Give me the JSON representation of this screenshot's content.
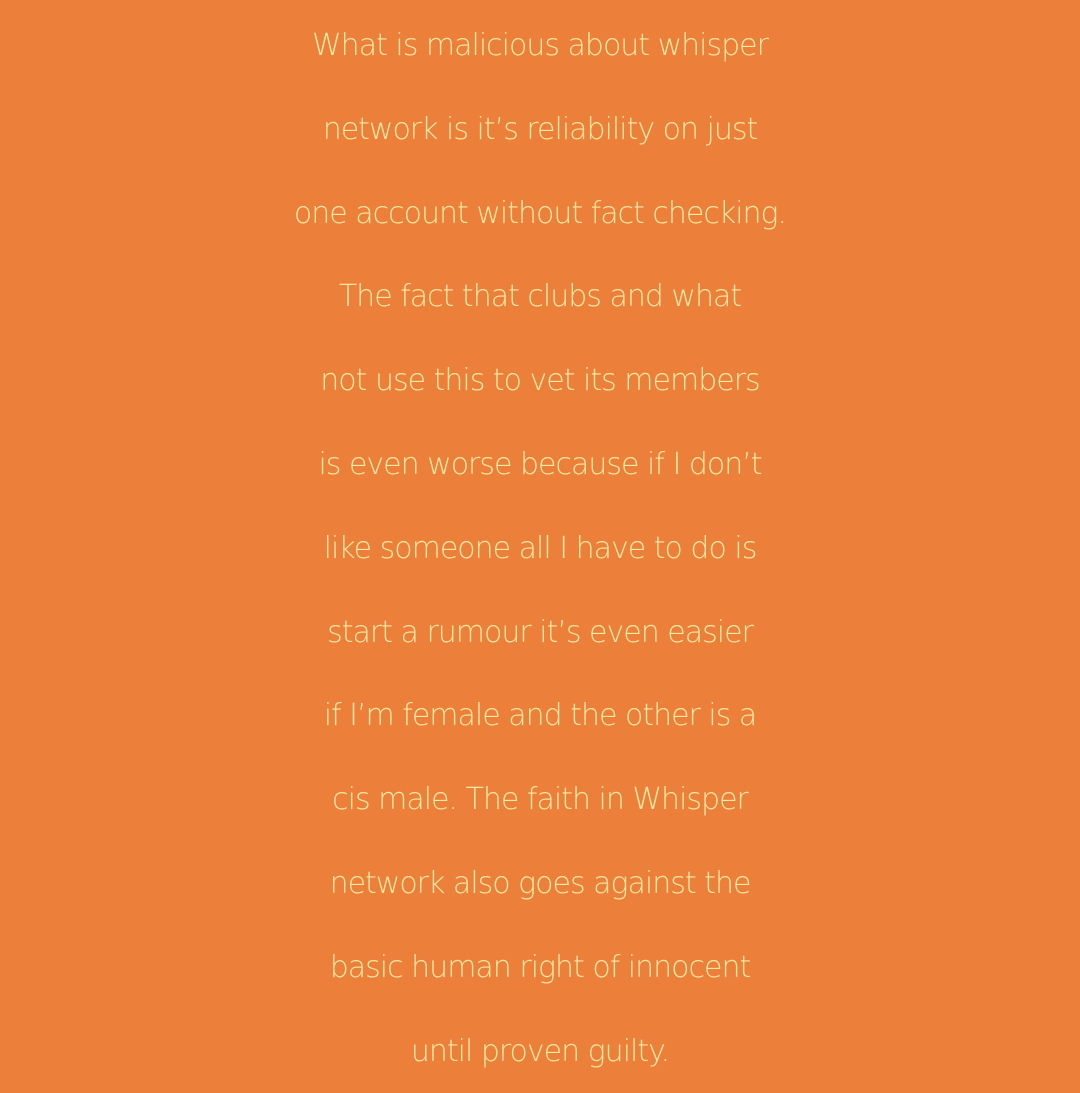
{
  "post": {
    "background_color": "#ec7f39",
    "text_color": "#fbeaa4",
    "lines": [
      "What is malicious about whisper",
      "network is it’s reliability on just",
      "one account without fact checking.",
      "The fact that clubs and what",
      "not use this to vet its members",
      "is even worse because if I don’t",
      "like someone all I have to do is",
      "start a rumour it’s even easier",
      "if I’m female and the other is a",
      "cis male. The faith in Whisper",
      "network also goes against the",
      "basic human right of innocent",
      "until proven guilty."
    ]
  }
}
